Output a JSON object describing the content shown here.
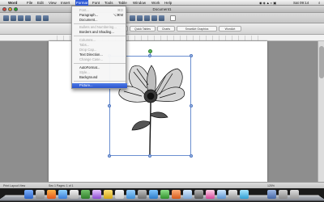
{
  "menubar": {
    "apple_glyph": "",
    "items": [
      "Word",
      "File",
      "Edit",
      "View",
      "Insert",
      "Format",
      "Font",
      "Tools",
      "Table",
      "Window",
      "Work",
      "Help"
    ],
    "active_index": 5,
    "clock": "Sat 09:14",
    "search_glyph": "⌕"
  },
  "window": {
    "title": "Document1",
    "ribbon_tabs": [
      "Document Elements",
      "Quick Tables",
      "Charts",
      "SmartArt Graphics",
      "WordArt"
    ]
  },
  "format_menu": {
    "items": [
      {
        "label": "Font...",
        "shortcut": "⌘D",
        "disabled": true
      },
      {
        "label": "Paragraph...",
        "shortcut": "⌥⌘M",
        "disabled": false
      },
      {
        "label": "Document...",
        "shortcut": "",
        "disabled": false
      },
      {
        "label": "Bullets and Numbering...",
        "shortcut": "",
        "disabled": true
      },
      {
        "label": "Borders and Shading...",
        "shortcut": "",
        "disabled": false
      },
      {
        "label": "Columns...",
        "shortcut": "",
        "disabled": true
      },
      {
        "label": "Tabs...",
        "shortcut": "",
        "disabled": true
      },
      {
        "label": "Drop Cap...",
        "shortcut": "",
        "disabled": true
      },
      {
        "label": "Text Direction...",
        "shortcut": "",
        "disabled": false
      },
      {
        "label": "Change Case...",
        "shortcut": "",
        "disabled": true
      },
      {
        "label": "AutoFormat...",
        "shortcut": "",
        "disabled": false
      },
      {
        "label": "Style...",
        "shortcut": "",
        "disabled": true
      },
      {
        "label": "Background",
        "shortcut": "",
        "disabled": false
      },
      {
        "label": "Picture...",
        "shortcut": "",
        "disabled": false,
        "highlighted": true
      }
    ]
  },
  "statusbar": {
    "view_label": "Print Layout View",
    "page_info": "Sec 1   Pages: 1 of 1",
    "zoom": "125%"
  },
  "colors": {
    "menu_highlight": "#2b55cc",
    "selection_border": "#6b8fd0",
    "rotate_handle": "#5fb95f"
  }
}
